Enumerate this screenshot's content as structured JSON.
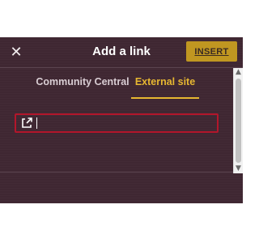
{
  "dialog": {
    "title": "Add a link",
    "close_icon": "close-icon",
    "insert_label": "INSERT"
  },
  "tabs": [
    {
      "label": "Community Central",
      "active": false
    },
    {
      "label": "External site",
      "active": true
    }
  ],
  "url_field": {
    "icon": "external-link-icon",
    "value": "",
    "placeholder": ""
  },
  "colors": {
    "background": "#3f2732",
    "accent": "#e7b731",
    "button": "#c09721",
    "input_border": "#b3162b"
  }
}
